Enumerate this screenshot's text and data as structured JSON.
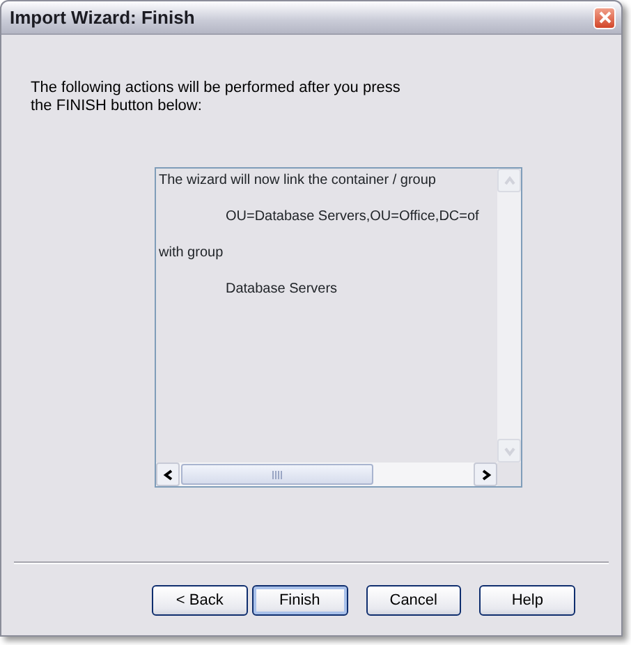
{
  "window": {
    "title": "Import Wizard: Finish"
  },
  "intro": "The following actions will be performed after you press the FINISH button below:",
  "summary": {
    "lines": [
      {
        "text": "The wizard will now link the container / group",
        "indented": false
      },
      {
        "text": "OU=Database Servers,OU=Office,DC=of",
        "indented": true
      },
      {
        "text": "with group",
        "indented": false
      },
      {
        "text": "Database Servers",
        "indented": true
      }
    ],
    "vertical_scrollbar": {
      "disabled": true
    },
    "horizontal_scrollbar": {
      "disabled": false
    }
  },
  "buttons": [
    {
      "label": "< Back",
      "default": false
    },
    {
      "label": "Finish",
      "default": true
    },
    {
      "label": "Cancel",
      "default": false
    },
    {
      "label": "Help",
      "default": false
    }
  ]
}
